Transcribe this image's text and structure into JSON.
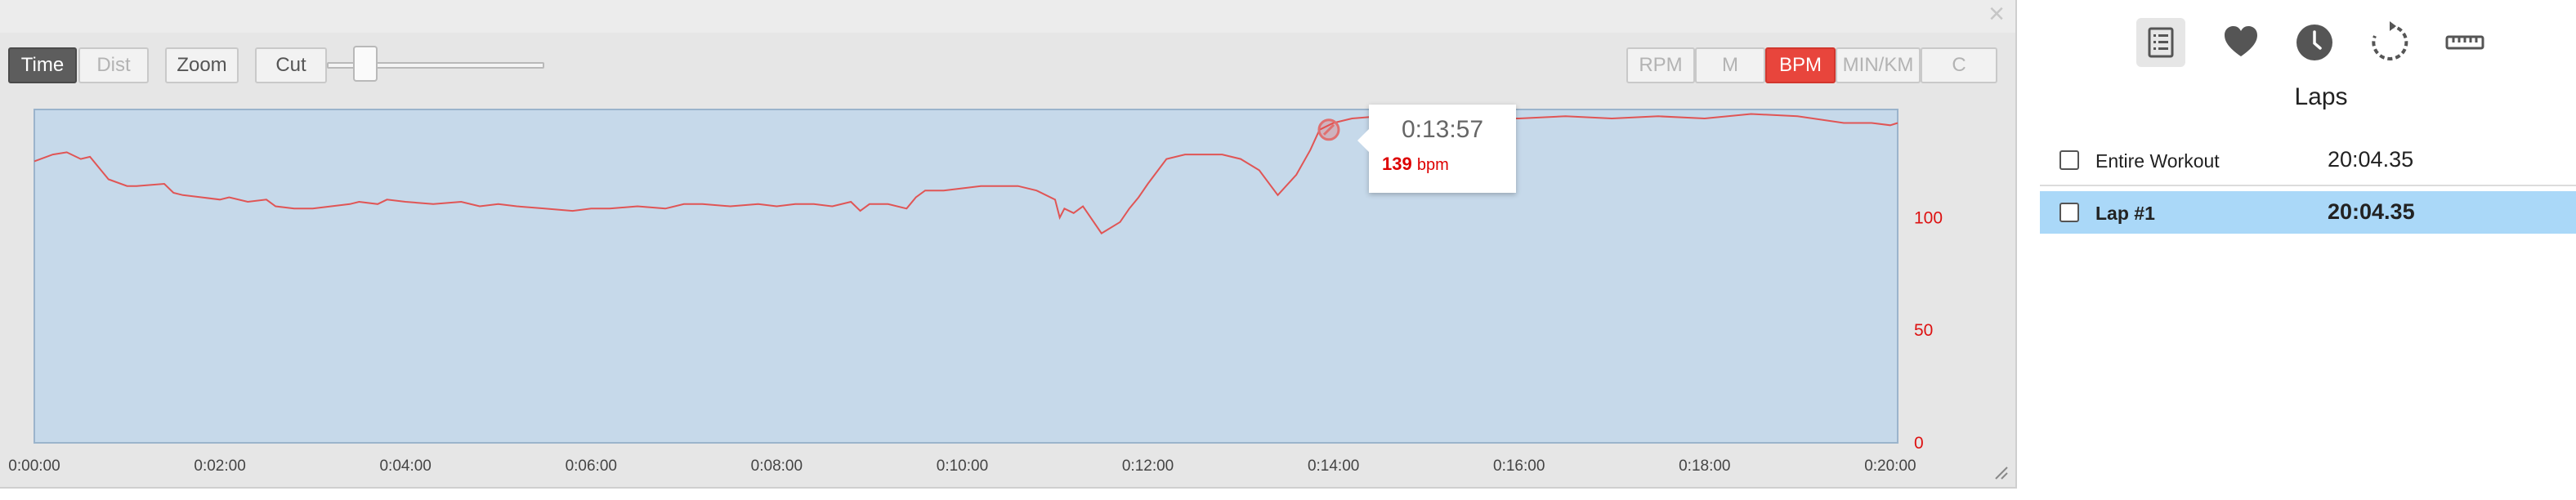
{
  "toolbar": {
    "time_label": "Time",
    "dist_label": "Dist",
    "zoom_label": "Zoom",
    "cut_label": "Cut",
    "metric_buttons": [
      "RPM",
      "M",
      "BPM",
      "MIN/KM",
      "C"
    ],
    "active_metric": "BPM"
  },
  "colors": {
    "accent": "#e8453c",
    "line": "#e05555",
    "plot_bg": "#c6d9ea",
    "lap_selected": "#aad8f8"
  },
  "chart_data": {
    "type": "line",
    "xlabel": "",
    "ylabel": "",
    "x_ticks": [
      "0:00:00",
      "0:02:00",
      "0:04:00",
      "0:06:00",
      "0:08:00",
      "0:10:00",
      "0:12:00",
      "0:14:00",
      "0:16:00",
      "0:18:00",
      "0:20:00"
    ],
    "y_ticks": [
      0,
      50,
      100
    ],
    "ylim": [
      0,
      148
    ],
    "xlim_min": [
      0,
      20.08
    ],
    "series": [
      {
        "x": [
          0,
          0.2,
          0.35,
          0.5,
          0.6,
          0.8,
          1.0,
          1.1,
          1.4,
          1.5,
          1.6,
          1.8,
          2.0,
          2.1,
          2.3,
          2.5,
          2.6,
          2.8,
          3.0,
          3.2,
          3.4,
          3.5,
          3.7,
          3.8,
          4.0,
          4.3,
          4.6,
          4.8,
          5.0,
          5.2,
          5.5,
          5.8,
          6.0,
          6.2,
          6.5,
          6.8,
          7.0,
          7.2,
          7.5,
          7.8,
          8.0,
          8.2,
          8.4,
          8.6,
          8.8,
          8.9,
          9.0,
          9.2,
          9.4,
          9.5,
          9.6,
          9.8,
          10.0,
          10.2,
          10.4,
          10.6,
          10.8,
          11.0,
          11.05,
          11.1,
          11.2,
          11.3,
          11.5,
          11.7,
          11.8,
          11.9,
          12.0,
          12.2,
          12.4,
          12.6,
          12.8,
          13.0,
          13.2,
          13.4,
          13.6,
          13.75,
          13.85,
          14.0,
          14.2,
          14.5,
          15.0,
          15.5,
          16.0,
          16.5,
          17.0,
          17.5,
          18.0,
          18.5,
          19.0,
          19.5,
          19.8,
          20.0,
          20.08
        ],
        "y": [
          125,
          128,
          129,
          126,
          127,
          117,
          114,
          114,
          115,
          111,
          110,
          109,
          108,
          109,
          107,
          108,
          105,
          104,
          104,
          105,
          106,
          107,
          106,
          108,
          107,
          106,
          107,
          105,
          106,
          105,
          104,
          103,
          104,
          104,
          105,
          104,
          106,
          106,
          105,
          106,
          105,
          106,
          106,
          105,
          107,
          103,
          106,
          106,
          104,
          109,
          112,
          112,
          113,
          114,
          114,
          114,
          112,
          108,
          100,
          104,
          102,
          105,
          93,
          98,
          104,
          109,
          115,
          126,
          128,
          128,
          128,
          126,
          121,
          110,
          119,
          130,
          139,
          142,
          144,
          145,
          144,
          144,
          144,
          145,
          144,
          145,
          144,
          146,
          145,
          142,
          142,
          141,
          142
        ]
      }
    ],
    "tooltip": {
      "time": "0:13:57",
      "value": "139",
      "unit": "bpm"
    }
  },
  "laps": {
    "title": "Laps",
    "rows": [
      {
        "name": "Entire Workout",
        "time": "20:04.35",
        "selected": false
      },
      {
        "name": "Lap #1",
        "time": "20:04.35",
        "selected": true
      }
    ]
  },
  "icons": [
    "list-icon",
    "heart-icon",
    "clock-icon",
    "refresh-icon",
    "ruler-icon"
  ]
}
